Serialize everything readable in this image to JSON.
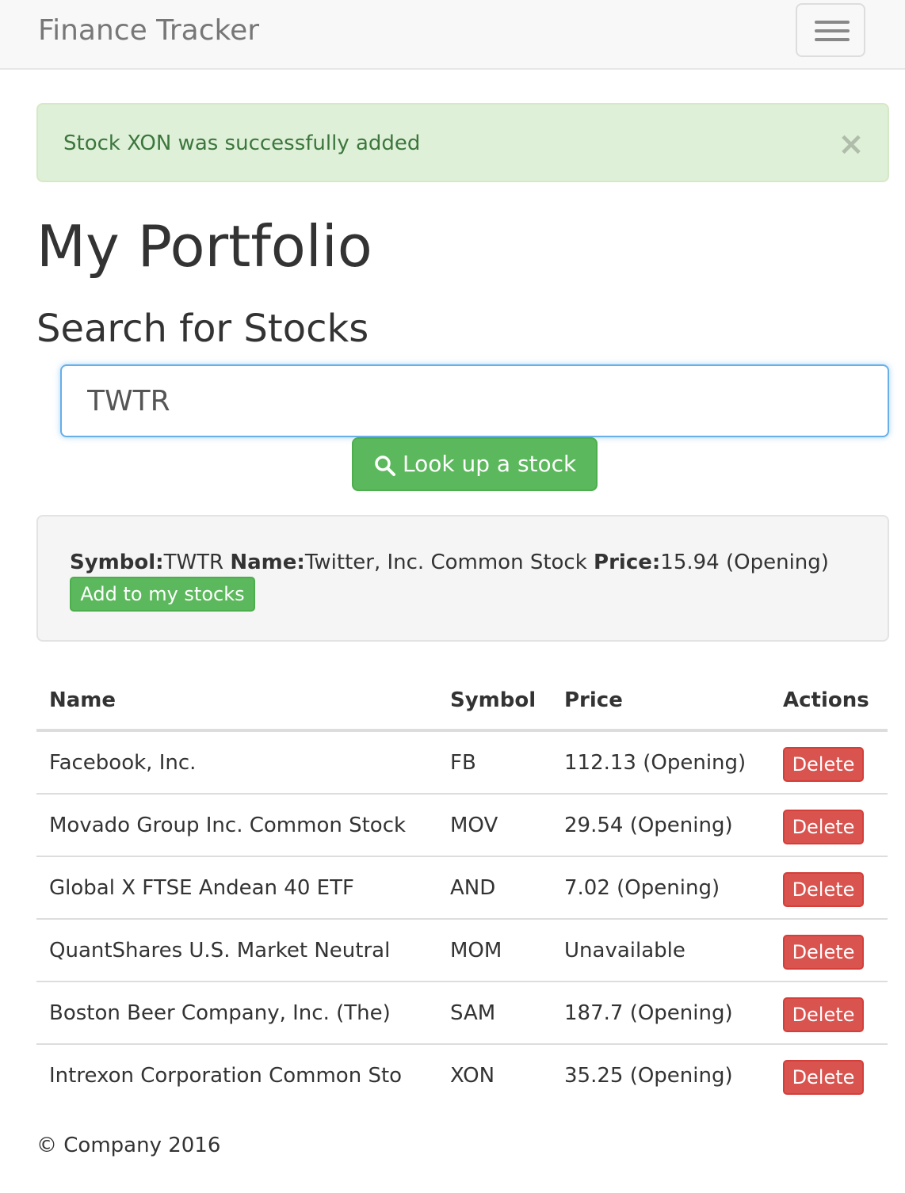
{
  "navbar": {
    "brand": "Finance Tracker",
    "toggle_icon": "hamburger-menu-icon"
  },
  "alert": {
    "message": "Stock XON was successfully added",
    "close_glyph": "×",
    "close_icon": "close-icon",
    "color": "#3c763d"
  },
  "page": {
    "title": "My Portfolio",
    "search_heading": "Search for Stocks"
  },
  "search": {
    "value": "TWTR",
    "button_label": "Look up a stock",
    "button_icon": "search-icon"
  },
  "result": {
    "symbol_label": "Symbol:",
    "symbol": "TWTR",
    "name_label": "Name:",
    "name": "Twitter, Inc. Common Stock",
    "price_label": "Price:",
    "price": "15.94 (Opening)",
    "add_button": "Add to my stocks"
  },
  "table": {
    "headers": [
      "Name",
      "Symbol",
      "Price",
      "Actions"
    ],
    "delete_label": "Delete",
    "rows": [
      {
        "name": "Facebook, Inc.",
        "symbol": "FB",
        "price": "112.13 (Opening)"
      },
      {
        "name": "Movado Group Inc. Common Stock",
        "symbol": "MOV",
        "price": "29.54 (Opening)"
      },
      {
        "name": "Global X FTSE Andean 40 ETF",
        "symbol": "AND",
        "price": "7.02 (Opening)"
      },
      {
        "name": "QuantShares U.S. Market Neutral",
        "symbol": "MOM",
        "price": "Unavailable"
      },
      {
        "name": "Boston Beer Company, Inc. (The)",
        "symbol": "SAM",
        "price": "187.7 (Opening)"
      },
      {
        "name": "Intrexon Corporation Common Sto",
        "symbol": "XON",
        "price": "35.25 (Opening)"
      }
    ]
  },
  "footer": {
    "text": "© Company 2016"
  },
  "colors": {
    "success": "#5cb85c",
    "danger": "#d9534f",
    "alert_bg": "#dff0d8"
  }
}
